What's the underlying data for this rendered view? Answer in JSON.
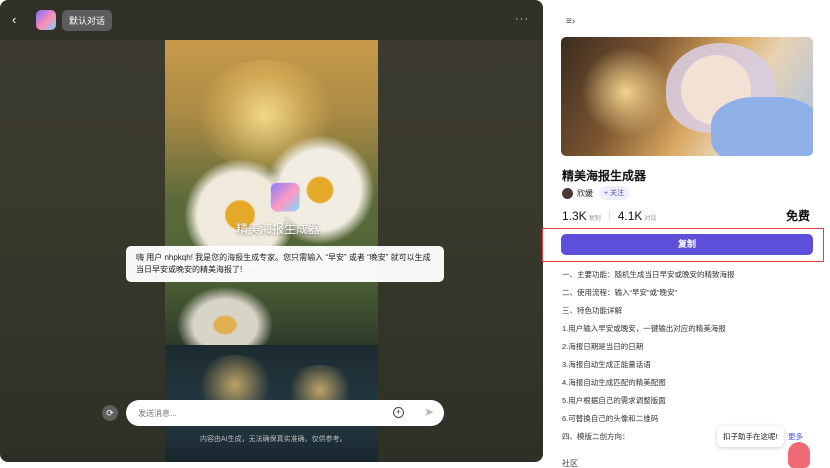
{
  "chat": {
    "back_label": "‹",
    "title": "默认对话",
    "more_label": "···",
    "poster_name": "精美海报生成器",
    "greeting": "嗨 用户 nhpkqh! 我是您的海报生成专家。您只需输入 “早安” 或者 “晚安” 就可以生成当日早安或晚安的精美海报了!",
    "input_placeholder": "发送消息...",
    "disclaimer": "内容由AI生成，无法确保真实准确，仅供参考。",
    "icons": [
      "back-icon",
      "refresh-icon",
      "plus-circle-icon",
      "send-icon",
      "more-icon"
    ]
  },
  "panel": {
    "menu_icon": "collapse-menu-icon",
    "bot_title": "精美海报生成器",
    "author": "欣媛",
    "follow_label": "+ 关注",
    "stats": {
      "copies": "1.3K",
      "copies_label": "复制",
      "chats": "4.1K",
      "chats_label": "对话",
      "price": "免费"
    },
    "copy_button": "复制",
    "description": [
      "一、主要功能：随机生成当日早安或晚安的精致海报",
      "二、使用流程：输入“早安”或“晚安”",
      "三、特色功能详解",
      "1.用户输入早安或晚安，一键输出对应的精美海报",
      "2.海报日期是当日的日期",
      "3.海报自动生成正能量话语",
      "4.海报自动生成匹配的精美配图",
      "5.用户根据自己的需求调整版面",
      "6.可替换自己的头像和二维码",
      "四、模版二创方向："
    ],
    "community_label": "社区",
    "helper_text": "扣子助手在这呢!",
    "more_label": "更多"
  },
  "colors": {
    "accent": "#5d4fd9",
    "highlight_border": "#e04040"
  }
}
